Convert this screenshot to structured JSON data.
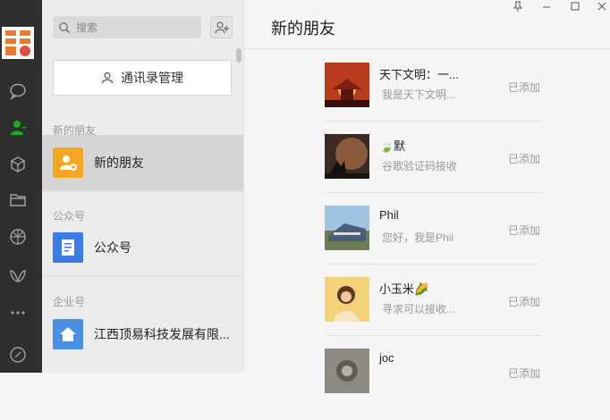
{
  "search": {
    "placeholder": "搜索"
  },
  "contacts_manage": {
    "label": "通讯录管理"
  },
  "sections": {
    "new_friends": "新的朋友",
    "official": "公众号",
    "enterprise": "企业号"
  },
  "list": {
    "new_friends_item": "新的朋友",
    "official_item": "公众号",
    "enterprise_item": "江西顶易科技发展有限..."
  },
  "panel": {
    "title": "新的朋友"
  },
  "friends": [
    {
      "name": "天下文明：一...",
      "message": "我是天下文明...",
      "status": "已添加"
    },
    {
      "name": "🍃默",
      "message": "谷歌验证码接收",
      "status": "已添加"
    },
    {
      "name": "Phil",
      "message": "您好，我是Phil",
      "status": "已添加"
    },
    {
      "name": "小玉米🌽",
      "message": "寻求可以接收...",
      "status": "已添加"
    },
    {
      "name": "joc",
      "message": "",
      "status": "已添加"
    }
  ],
  "colors": {
    "accent_green": "#1aad19",
    "orange": "#f5a623",
    "blue": "#3a7be6"
  }
}
